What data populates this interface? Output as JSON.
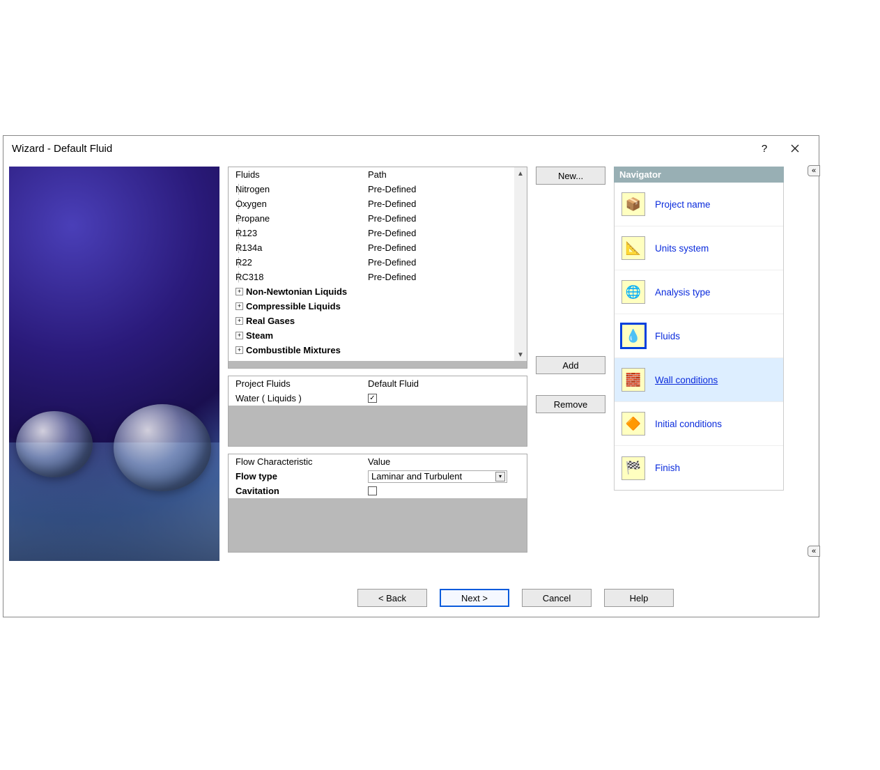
{
  "window": {
    "title": "Wizard - Default Fluid",
    "help": "?",
    "close": "×"
  },
  "fluids_table": {
    "headers": {
      "c1": "Fluids",
      "c2": "Path"
    },
    "leaves": [
      {
        "name": "Nitrogen",
        "path": "Pre-Defined"
      },
      {
        "name": "Oxygen",
        "path": "Pre-Defined"
      },
      {
        "name": "Propane",
        "path": "Pre-Defined"
      },
      {
        "name": "R123",
        "path": "Pre-Defined"
      },
      {
        "name": "R134a",
        "path": "Pre-Defined"
      },
      {
        "name": "R22",
        "path": "Pre-Defined"
      },
      {
        "name": "RC318",
        "path": "Pre-Defined"
      }
    ],
    "groups": [
      "Non-Newtonian Liquids",
      "Compressible Liquids",
      "Real Gases",
      "Steam",
      "Combustible Mixtures"
    ]
  },
  "project_fluids": {
    "headers": {
      "c1": "Project Fluids",
      "c2": "Default Fluid"
    },
    "row": {
      "name": "Water ( Liquids )",
      "checked": true
    }
  },
  "flow": {
    "headers": {
      "c1": "Flow Characteristic",
      "c2": "Value"
    },
    "flow_type": {
      "label": "Flow type",
      "value": "Laminar and Turbulent"
    },
    "cavitation": {
      "label": "Cavitation",
      "checked": false
    }
  },
  "side_buttons": {
    "new": "New...",
    "add": "Add",
    "remove": "Remove"
  },
  "navigator": {
    "title": "Navigator",
    "items": [
      {
        "label": "Project name",
        "icon": "📦"
      },
      {
        "label": "Units system",
        "icon": "📐"
      },
      {
        "label": "Analysis type",
        "icon": "🌐"
      },
      {
        "label": "Fluids",
        "icon": "💧"
      },
      {
        "label": "Wall conditions",
        "icon": "🧱"
      },
      {
        "label": "Initial conditions",
        "icon": "🔶"
      },
      {
        "label": "Finish",
        "icon": "🏁"
      }
    ]
  },
  "footer": {
    "back": "< Back",
    "next": "Next >",
    "cancel": "Cancel",
    "help": "Help"
  }
}
